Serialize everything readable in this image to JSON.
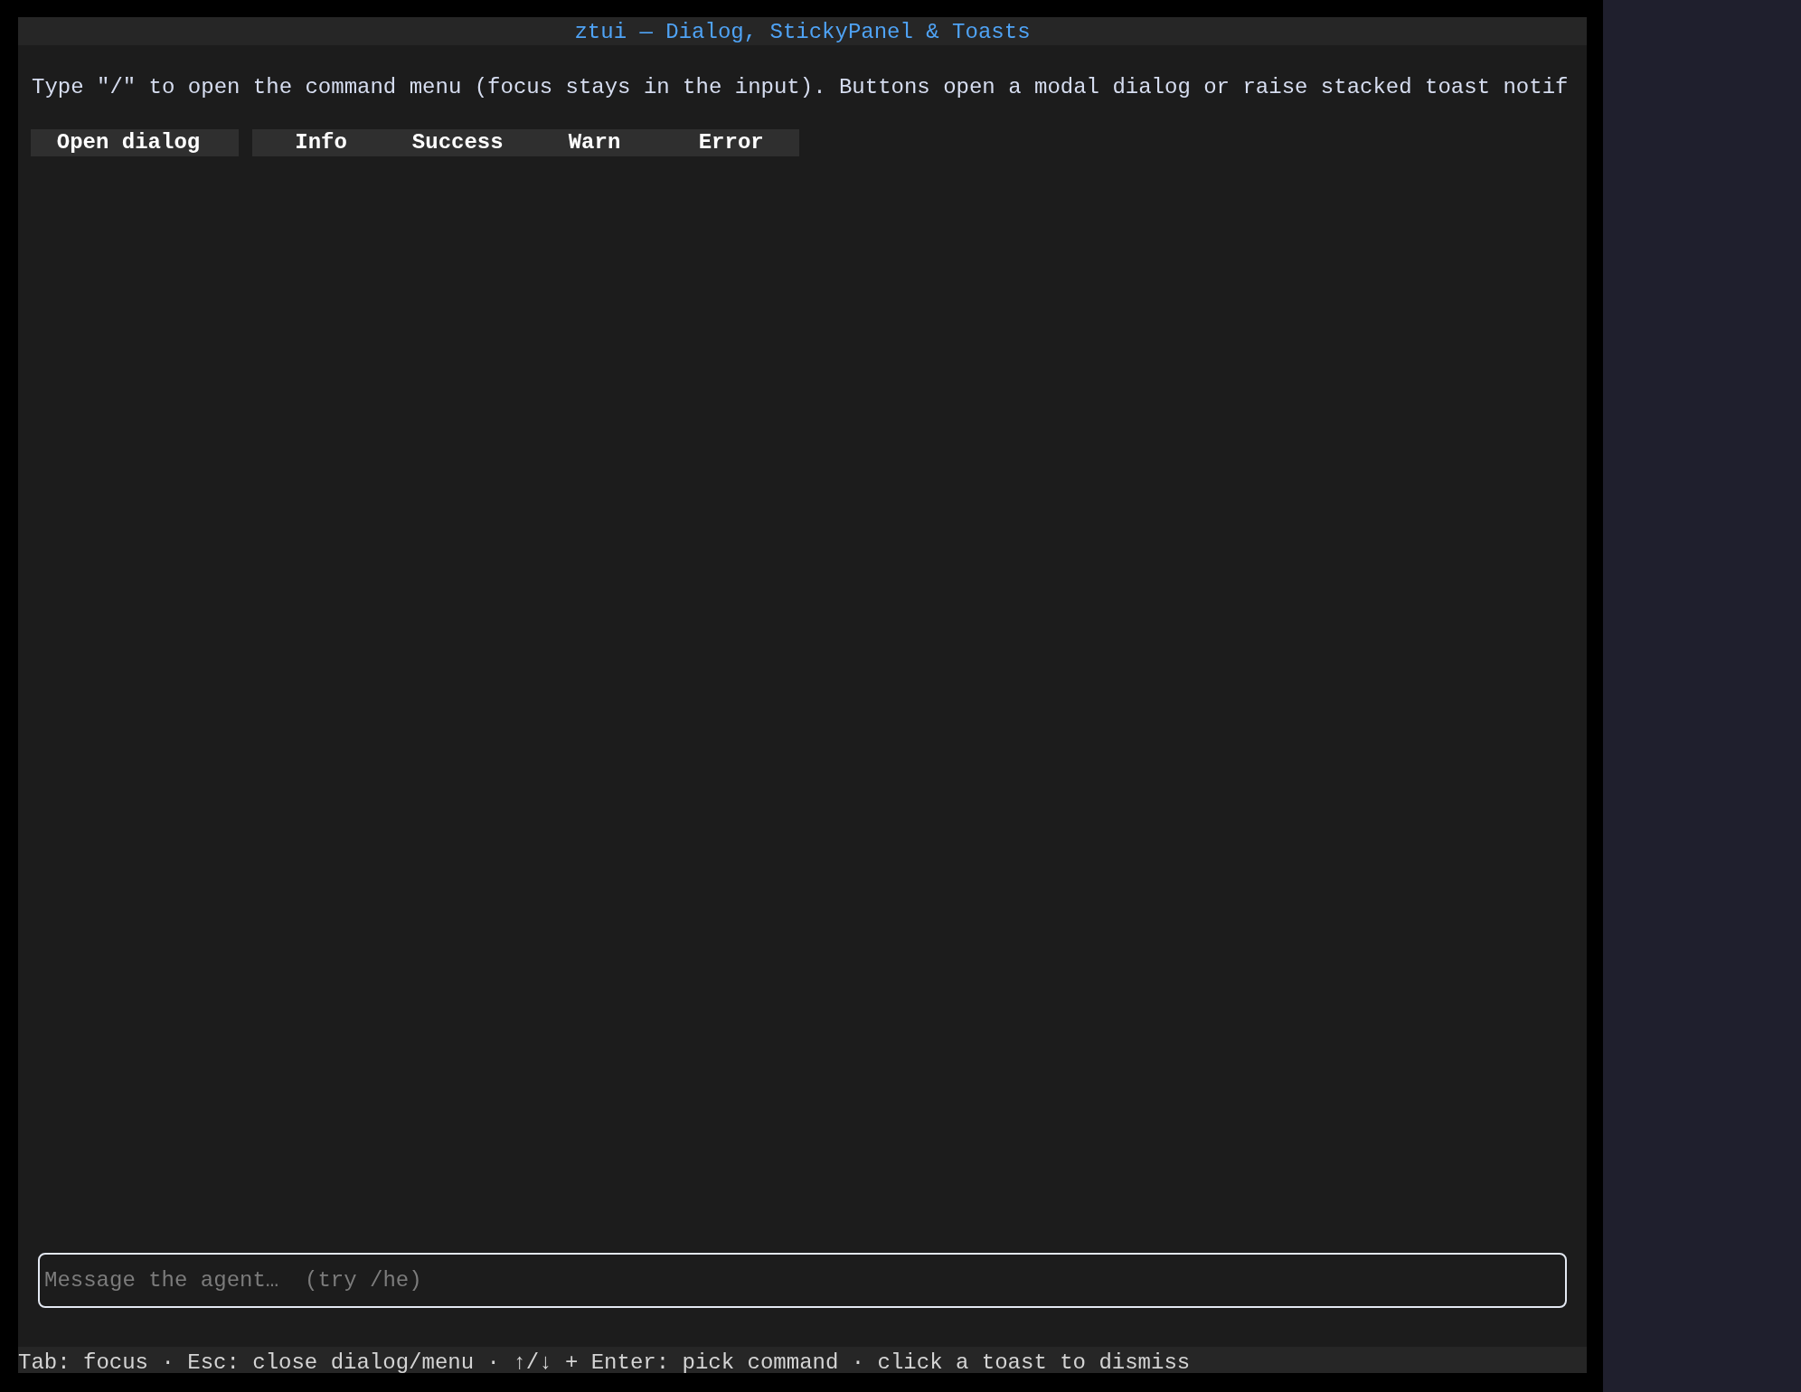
{
  "window": {
    "title": "ztui — Dialog, StickyPanel & Toasts"
  },
  "intro": "Type \"/\" to open the command menu (focus stays in the input). Buttons open a modal dialog or raise stacked toast notif",
  "button_groups": [
    [
      "Open dialog"
    ],
    [
      "Info",
      "Success",
      "Warn",
      "Error"
    ]
  ],
  "composer": {
    "placeholder": "Message the agent…  (try /he)"
  },
  "status_bar": "Tab: focus · Esc: close dialog/menu · ↑/↓ + Enter: pick command · click a toast to dismiss"
}
